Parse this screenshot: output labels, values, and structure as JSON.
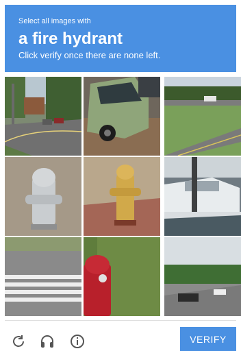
{
  "header": {
    "instruction_pre": "Select all images with",
    "target": "a fire hydrant",
    "instruction_post": "Click verify once there are none left."
  },
  "grid": {
    "tiles": [
      {
        "description": "street intersection with trees and houses"
      },
      {
        "description": "green car parked on street"
      },
      {
        "description": "road with grass field and truck"
      },
      {
        "description": "silver fire hydrant on gravel"
      },
      {
        "description": "yellow fire hydrant on sidewalk"
      },
      {
        "description": "boats at marina"
      },
      {
        "description": "road crosswalk"
      },
      {
        "description": "red fire hydrant in grass"
      },
      {
        "description": "road with cars and trees"
      }
    ]
  },
  "footer": {
    "icons": [
      "reload-icon",
      "headphones-icon",
      "info-icon"
    ],
    "verify_label": "VERIFY"
  },
  "colors": {
    "accent": "#4a90e2",
    "icon": "#555555"
  }
}
